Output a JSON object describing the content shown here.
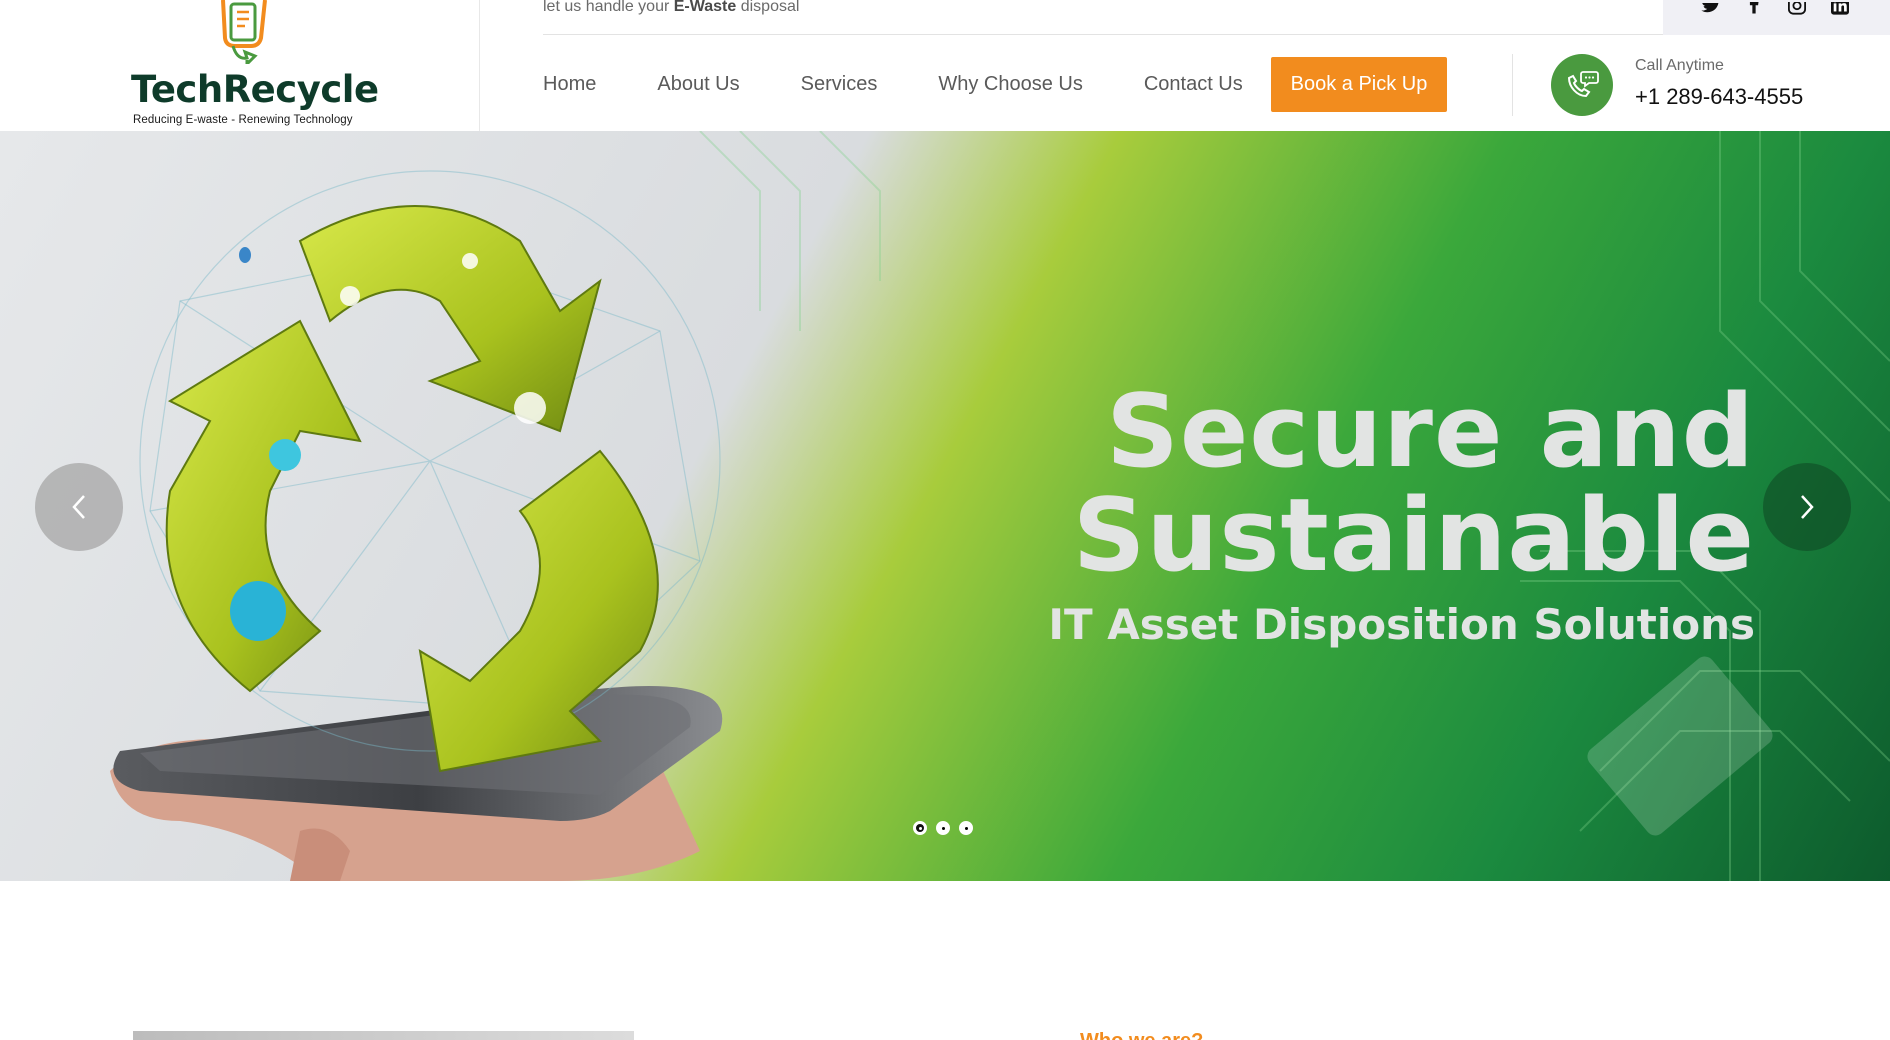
{
  "header": {
    "logo": {
      "name": "TechRecycle",
      "tagline": "Reducing E-waste - Renewing Technology"
    },
    "topbar": {
      "text_before": "let us handle your ",
      "text_bold": "E-Waste",
      "text_after": " disposal"
    },
    "social": [
      {
        "icon": "twitter-icon"
      },
      {
        "icon": "facebook-icon"
      },
      {
        "icon": "instagram-icon"
      },
      {
        "icon": "linkedin-icon"
      }
    ],
    "nav": {
      "items": [
        {
          "label": "Home"
        },
        {
          "label": "About Us"
        },
        {
          "label": "Services"
        },
        {
          "label": "Why Choose Us"
        },
        {
          "label": "Contact Us"
        }
      ],
      "cta_label": "Book a Pick Up"
    },
    "call": {
      "label": "Call Anytime",
      "number": "+1 289-643-4555",
      "icon": "phone-chat-icon"
    }
  },
  "hero": {
    "line1": "Secure and",
    "line2": "Sustainable",
    "line3": "IT Asset Disposition Solutions",
    "slides_total": 3,
    "active_slide": 1
  },
  "about": {
    "kicker": "Who we are?"
  },
  "colors": {
    "brand_green": "#4a9a3f",
    "brand_dark_green": "#0e3b2a",
    "accent_orange": "#f28c1e"
  }
}
